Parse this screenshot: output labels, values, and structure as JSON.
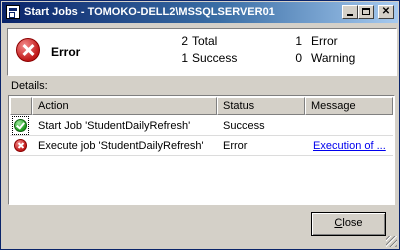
{
  "window": {
    "title": "Start Jobs - TOMOKO-DELL2\\MSSQLSERVER01",
    "icon": "dialog-icon"
  },
  "summary": {
    "status_title": "Error",
    "status_icon": "error-icon",
    "counts": [
      {
        "value": "2",
        "label": "Total"
      },
      {
        "value": "1",
        "label": "Success"
      },
      {
        "value": "1",
        "label": "Error"
      },
      {
        "value": "0",
        "label": "Warning"
      }
    ]
  },
  "details": {
    "label": "Details:",
    "columns": [
      "Action",
      "Status",
      "Message"
    ],
    "rows": [
      {
        "icon": "success-icon",
        "action": "Start Job 'StudentDailyRefresh'",
        "status": "Success",
        "message": ""
      },
      {
        "icon": "error-icon",
        "action": "Execute job 'StudentDailyRefresh'",
        "status": "Error",
        "message": "Execution of ..."
      }
    ]
  },
  "buttons": {
    "close_first": "C",
    "close_rest": "lose"
  },
  "colors": {
    "titlebar": "#0a246a",
    "face": "#d4d0c8",
    "link": "#0000ee",
    "error": "#c01818",
    "success": "#1c9a1c"
  }
}
